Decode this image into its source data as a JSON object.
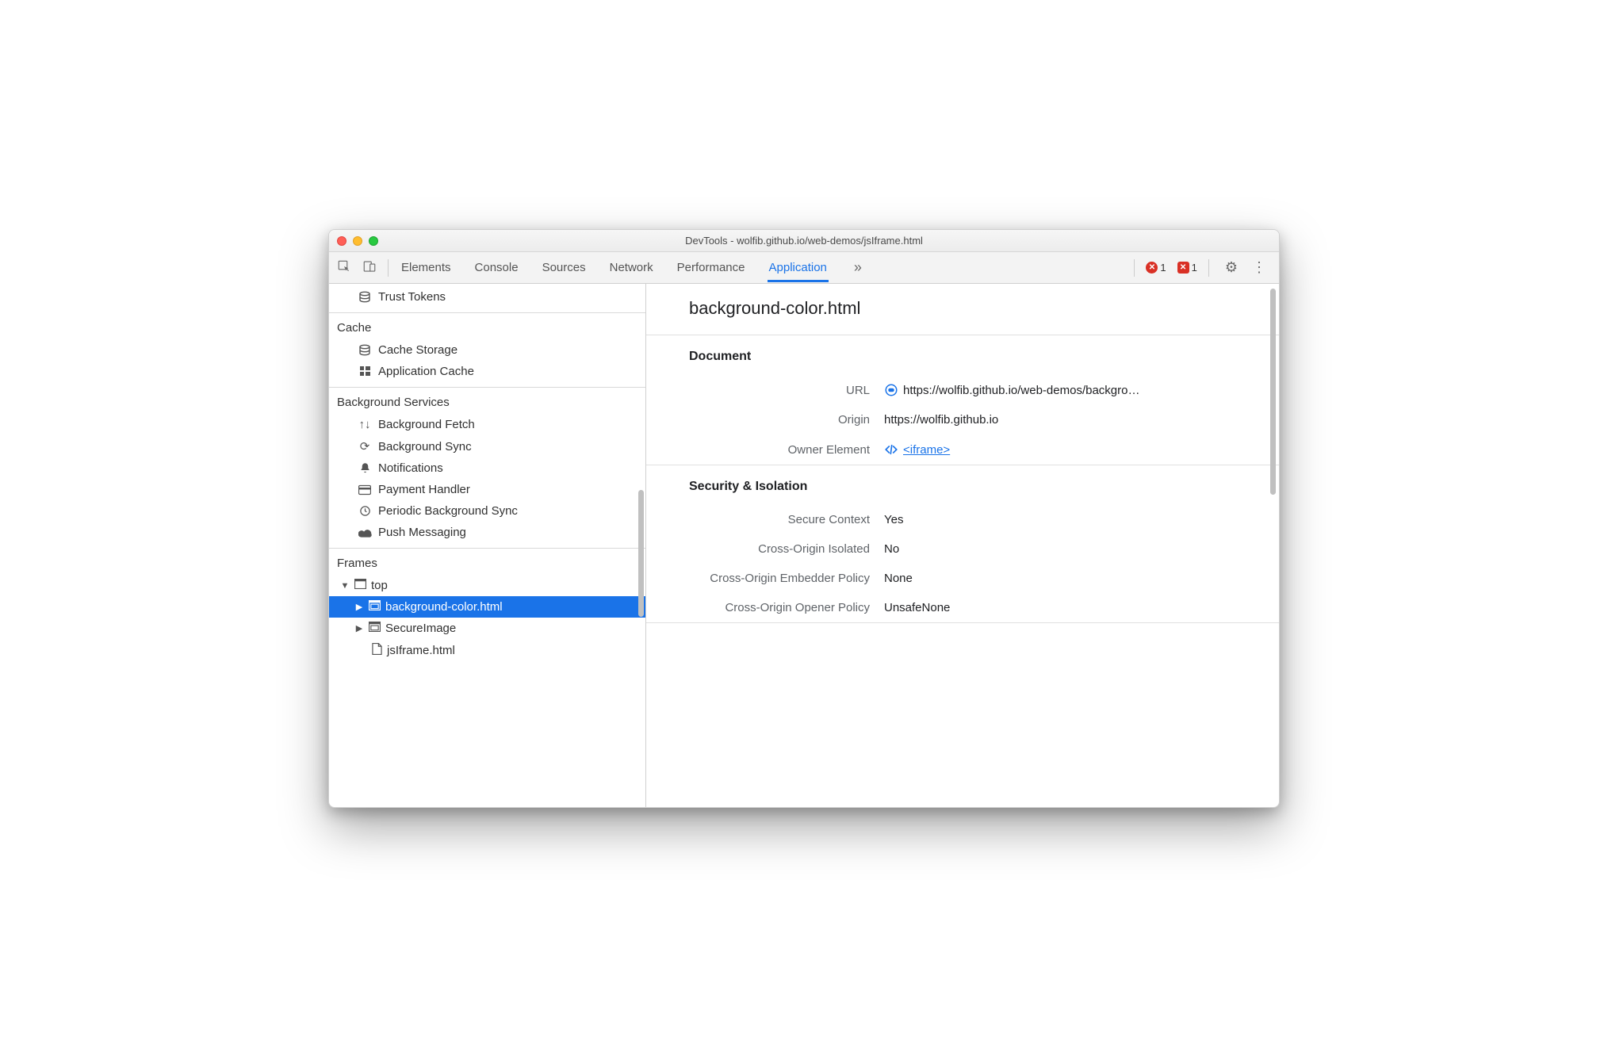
{
  "window": {
    "title": "DevTools - wolfib.github.io/web-demos/jsIframe.html"
  },
  "toolbar": {
    "tabs": [
      "Elements",
      "Console",
      "Sources",
      "Network",
      "Performance",
      "Application"
    ],
    "active_tab": "Application",
    "error_badge": "1",
    "error_badge2": "1"
  },
  "sidebar": {
    "top_item": "Trust Tokens",
    "sections": [
      {
        "heading": "Cache",
        "items": [
          "Cache Storage",
          "Application Cache"
        ]
      },
      {
        "heading": "Background Services",
        "items": [
          "Background Fetch",
          "Background Sync",
          "Notifications",
          "Payment Handler",
          "Periodic Background Sync",
          "Push Messaging"
        ]
      },
      {
        "heading": "Frames",
        "tree": {
          "top": "top",
          "children": [
            {
              "label": "background-color.html",
              "selected": true
            },
            {
              "label": "SecureImage",
              "selected": false
            },
            {
              "label": "jsIframe.html",
              "selected": false,
              "leaf": true
            }
          ]
        }
      }
    ]
  },
  "main": {
    "heading": "background-color.html",
    "document": {
      "title": "Document",
      "url_label": "URL",
      "url_value": "https://wolfib.github.io/web-demos/backgro…",
      "origin_label": "Origin",
      "origin_value": "https://wolfib.github.io",
      "owner_label": "Owner Element",
      "owner_value": "<iframe>"
    },
    "security": {
      "title": "Security & Isolation",
      "rows": [
        {
          "k": "Secure Context",
          "v": "Yes"
        },
        {
          "k": "Cross-Origin Isolated",
          "v": "No"
        },
        {
          "k": "Cross-Origin Embedder Policy",
          "v": "None"
        },
        {
          "k": "Cross-Origin Opener Policy",
          "v": "UnsafeNone"
        }
      ]
    }
  }
}
